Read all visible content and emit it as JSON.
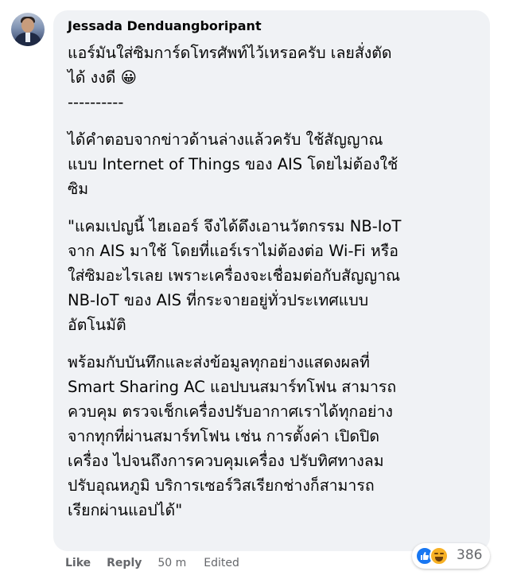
{
  "comment": {
    "author": "Jessada Denduangboripant",
    "paragraphs": [
      "แอร์มันใส่ซิมการ์ดโทรศัพท์ไว้เหรอครับ เลยสั่งตัด\nได้ งงดี 😀\n----------",
      "ได้คำตอบจากข่าวด้านล่างแล้วครับ ใช้สัญญาณ\nแบบ Internet of Things ของ AIS โดยไม่ต้องใช้\nซิม",
      "\"แคมเปญนี้ ไฮเออร์ จึงได้ดึงเอานวัตกรรม NB-IoT\nจาก AIS มาใช้ โดยที่แอร์เราไม่ต้องต่อ Wi-Fi หรือ\nใส่ซิมอะไรเลย เพราะเครื่องจะเชื่อมต่อกับสัญญาณ\nNB-IoT ของ AIS ที่กระจายอยู่ทั่วประเทศแบบ\nอัตโนมัติ",
      "พร้อมกับบันทึกและส่งข้อมูลทุกอย่างแสดงผลที่\nSmart Sharing AC แอปบนสมาร์ทโฟน สามารถ\nควบคุม ตรวจเช็กเครื่องปรับอากาศเราได้ทุกอย่าง\nจากทุกที่ผ่านสมาร์ทโฟน เช่น การตั้งค่า เปิดปิด\nเครื่อง ไปจนถึงการควบคุมเครื่อง ปรับทิศทางลม\nปรับอุณหภูมิ บริการเซอร์วิสเรียกช่างก็สามารถ\nเรียกผ่านแอปได้\""
    ],
    "reactions": {
      "count": "386",
      "types": [
        "like-icon",
        "haha-icon"
      ],
      "like_color": "#1877f2",
      "haha_color": "#f7b125"
    },
    "actions": {
      "like": "Like",
      "reply": "Reply",
      "time": "50 m",
      "edited": "Edited"
    }
  }
}
